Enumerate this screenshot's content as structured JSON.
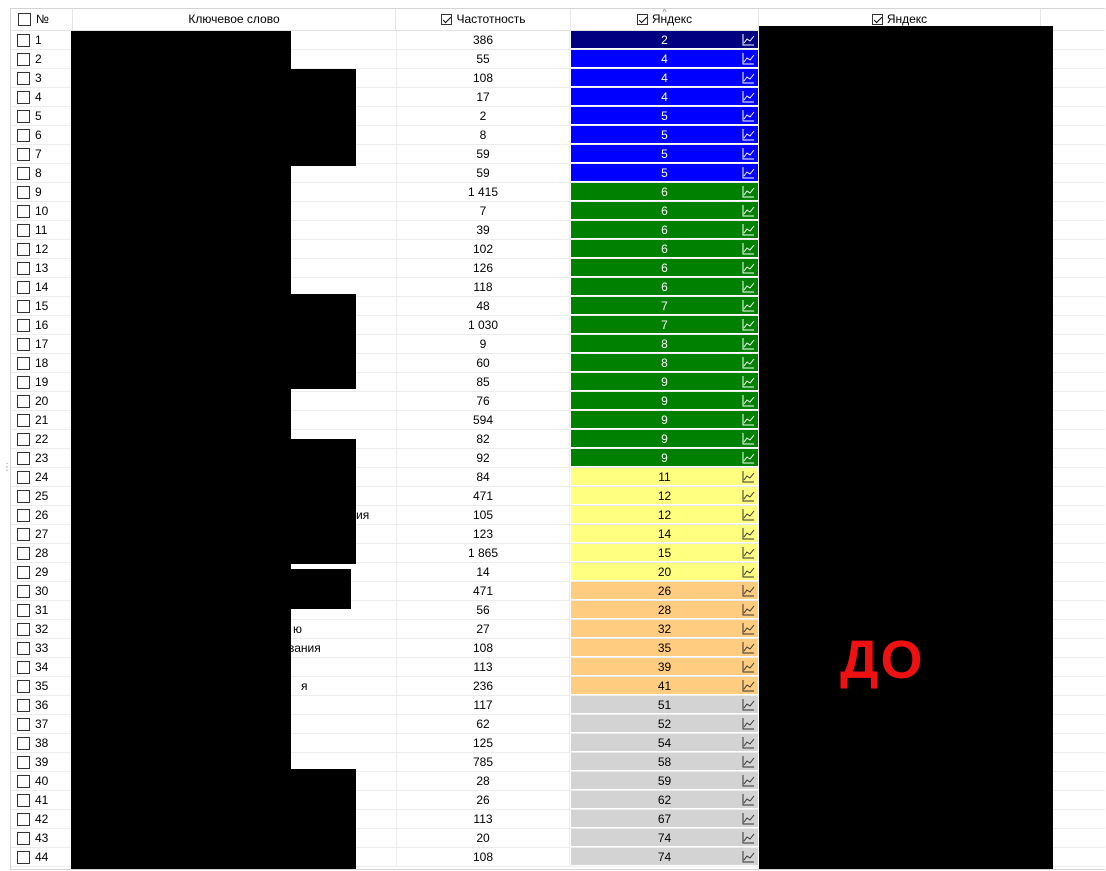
{
  "header": {
    "num": "№",
    "keyword": "Ключевое слово",
    "frequency": "Частотность",
    "yandex1": "Яндекс",
    "yandex2": "Яндекс"
  },
  "colors": {
    "darkblue": "#000080",
    "blue": "#0000ff",
    "green": "#008000",
    "yellow": "#ffff80",
    "orange": "#ffcc80",
    "gray": "#d3d3d3"
  },
  "rows": [
    {
      "n": "1",
      "freq": "386",
      "pos": "2",
      "color": "darkblue",
      "kw": ""
    },
    {
      "n": "2",
      "freq": "55",
      "pos": "4",
      "color": "blue",
      "kw": ""
    },
    {
      "n": "3",
      "freq": "108",
      "pos": "4",
      "color": "blue",
      "kw": ""
    },
    {
      "n": "4",
      "freq": "17",
      "pos": "4",
      "color": "blue",
      "kw": ""
    },
    {
      "n": "5",
      "freq": "2",
      "pos": "5",
      "color": "blue",
      "kw": ""
    },
    {
      "n": "6",
      "freq": "8",
      "pos": "5",
      "color": "blue",
      "kw": ""
    },
    {
      "n": "7",
      "freq": "59",
      "pos": "5",
      "color": "blue",
      "kw": ""
    },
    {
      "n": "8",
      "freq": "59",
      "pos": "5",
      "color": "blue",
      "kw": ""
    },
    {
      "n": "9",
      "freq": "1 415",
      "pos": "6",
      "color": "green",
      "kw": ""
    },
    {
      "n": "10",
      "freq": "7",
      "pos": "6",
      "color": "green",
      "kw": ""
    },
    {
      "n": "11",
      "freq": "39",
      "pos": "6",
      "color": "green",
      "kw": ""
    },
    {
      "n": "12",
      "freq": "102",
      "pos": "6",
      "color": "green",
      "kw": ""
    },
    {
      "n": "13",
      "freq": "126",
      "pos": "6",
      "color": "green",
      "kw": ""
    },
    {
      "n": "14",
      "freq": "118",
      "pos": "6",
      "color": "green",
      "kw": ""
    },
    {
      "n": "15",
      "freq": "48",
      "pos": "7",
      "color": "green",
      "kw": ""
    },
    {
      "n": "16",
      "freq": "1 030",
      "pos": "7",
      "color": "green",
      "kw": ""
    },
    {
      "n": "17",
      "freq": "9",
      "pos": "8",
      "color": "green",
      "kw": ""
    },
    {
      "n": "18",
      "freq": "60",
      "pos": "8",
      "color": "green",
      "kw": ""
    },
    {
      "n": "19",
      "freq": "85",
      "pos": "9",
      "color": "green",
      "kw": ""
    },
    {
      "n": "20",
      "freq": "76",
      "pos": "9",
      "color": "green",
      "kw": ""
    },
    {
      "n": "21",
      "freq": "594",
      "pos": "9",
      "color": "green",
      "kw": ""
    },
    {
      "n": "22",
      "freq": "82",
      "pos": "9",
      "color": "green",
      "kw": ""
    },
    {
      "n": "23",
      "freq": "92",
      "pos": "9",
      "color": "green",
      "kw": ""
    },
    {
      "n": "24",
      "freq": "84",
      "pos": "11",
      "color": "yellow",
      "kw": ""
    },
    {
      "n": "25",
      "freq": "471",
      "pos": "12",
      "color": "yellow",
      "kw": ""
    },
    {
      "n": "26",
      "freq": "105",
      "pos": "12",
      "color": "yellow",
      "kw": "ия"
    },
    {
      "n": "27",
      "freq": "123",
      "pos": "14",
      "color": "yellow",
      "kw": ""
    },
    {
      "n": "28",
      "freq": "1 865",
      "pos": "15",
      "color": "yellow",
      "kw": ""
    },
    {
      "n": "29",
      "freq": "14",
      "pos": "20",
      "color": "yellow",
      "kw": ""
    },
    {
      "n": "30",
      "freq": "471",
      "pos": "26",
      "color": "orange",
      "kw": ""
    },
    {
      "n": "31",
      "freq": "56",
      "pos": "28",
      "color": "orange",
      "kw": ""
    },
    {
      "n": "32",
      "freq": "27",
      "pos": "32",
      "color": "orange",
      "kw": "ю"
    },
    {
      "n": "33",
      "freq": "108",
      "pos": "35",
      "color": "orange",
      "kw": "вания"
    },
    {
      "n": "34",
      "freq": "113",
      "pos": "39",
      "color": "orange",
      "kw": ""
    },
    {
      "n": "35",
      "freq": "236",
      "pos": "41",
      "color": "orange",
      "kw": "я"
    },
    {
      "n": "36",
      "freq": "117",
      "pos": "51",
      "color": "gray",
      "kw": ""
    },
    {
      "n": "37",
      "freq": "62",
      "pos": "52",
      "color": "gray",
      "kw": ""
    },
    {
      "n": "38",
      "freq": "125",
      "pos": "54",
      "color": "gray",
      "kw": ""
    },
    {
      "n": "39",
      "freq": "785",
      "pos": "58",
      "color": "gray",
      "kw": ""
    },
    {
      "n": "40",
      "freq": "28",
      "pos": "59",
      "color": "gray",
      "kw": ""
    },
    {
      "n": "41",
      "freq": "26",
      "pos": "62",
      "color": "gray",
      "kw": ""
    },
    {
      "n": "42",
      "freq": "113",
      "pos": "67",
      "color": "gray",
      "kw": ""
    },
    {
      "n": "43",
      "freq": "20",
      "pos": "74",
      "color": "gray",
      "kw": ""
    },
    {
      "n": "44",
      "freq": "108",
      "pos": "74",
      "color": "gray",
      "kw": ""
    }
  ],
  "watermark": "ДО"
}
